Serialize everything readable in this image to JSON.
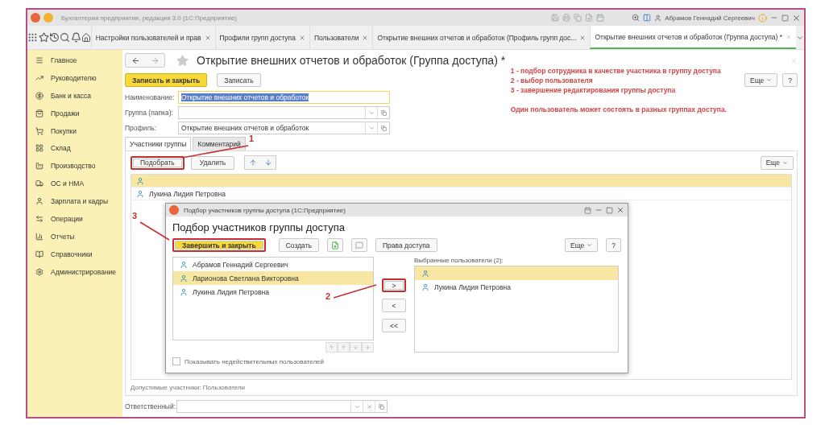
{
  "window": {
    "title": "Бухгалтерия предприятия, редакция 3.0  (1С:Предприятие)",
    "user": "Абрамов Геннадий Сергеевич"
  },
  "tabs": [
    {
      "label": "Настройки пользователей и прав",
      "selected": false
    },
    {
      "label": "Профили групп доступа",
      "selected": false
    },
    {
      "label": "Пользователи",
      "selected": false
    },
    {
      "label": "Открытие внешних отчетов и обработок (Профиль групп дос...",
      "selected": false
    },
    {
      "label": "Открытие внешних отчетов и обработок (Группа доступа) *",
      "selected": true
    }
  ],
  "sidebar": {
    "items": [
      {
        "label": "Главное"
      },
      {
        "label": "Руководителю"
      },
      {
        "label": "Банк и касса"
      },
      {
        "label": "Продажи"
      },
      {
        "label": "Покупки"
      },
      {
        "label": "Склад"
      },
      {
        "label": "Производство"
      },
      {
        "label": "ОС и НМА"
      },
      {
        "label": "Зарплата и кадры"
      },
      {
        "label": "Операции"
      },
      {
        "label": "Отчеты"
      },
      {
        "label": "Справочники"
      },
      {
        "label": "Администрирование"
      }
    ]
  },
  "form": {
    "title": "Открытие внешних отчетов и обработок (Группа доступа) *",
    "buttons": [
      {
        "label": "Записать и закрыть",
        "kind": "primary"
      },
      {
        "label": "Записать",
        "kind": "normal"
      }
    ],
    "more": "Еще",
    "help": "?",
    "fields": [
      {
        "label": "Наименование:",
        "value": "Открытие внешних отчетов и обработок",
        "kind": "text",
        "selected": true
      },
      {
        "label": "Группа (папка):",
        "kind": "select"
      },
      {
        "label": "Профиль:",
        "value": "Открытие внешних отчетов и обработок",
        "kind": "select"
      }
    ],
    "tabs": [
      {
        "label": "Участники группы",
        "selected": true
      },
      {
        "label": "Комментарий",
        "selected": false
      }
    ],
    "toolbar": [
      {
        "label": "Подобрать",
        "highlighted": true
      },
      {
        "label": "Удалить"
      }
    ],
    "table_more": "Еще",
    "rows": [
      {
        "selected": true
      },
      {
        "name": "Лукина Лидия Петровна",
        "selected": false
      }
    ],
    "footer": "Допустимые участники: Пользователи",
    "responsible": {
      "label": "Ответственный:"
    }
  },
  "notes": [
    "1 - подбор сотрудника в качестве участника в группу доступа",
    "2 - выбор пользователя",
    "3 - завершение редактирования группы доступа",
    "Один пользователь может состоять в разных группах доступа."
  ],
  "dialog": {
    "window_title": "Подбор участников группы доступа  (1С:Предприятие)",
    "title": "Подбор участников группы доступа",
    "buttons": [
      {
        "kind": "primary",
        "label": "Завершить и закрыть",
        "highlighted": true
      },
      {
        "kind": "normal",
        "label": "Создать"
      },
      {
        "kind": "add"
      },
      {
        "kind": "comment"
      },
      {
        "kind": "normal",
        "label": "Права доступа"
      }
    ],
    "more": "Еще",
    "help": "?",
    "users": [
      {
        "name": "Абрамов Геннадий Сергеевич",
        "selected": false
      },
      {
        "name": "Ларионова Светлана Викторовна",
        "selected": true
      },
      {
        "name": "Лукина Лидия Петровна",
        "selected": false
      }
    ],
    "move_buttons": [
      {
        "label": ">",
        "highlighted": true
      },
      {
        "label": "<"
      },
      {
        "label": "<<"
      }
    ],
    "chosen_label": "Выбранные пользователи (2):",
    "chosen": [
      {
        "selected": true
      },
      {
        "name": "Лукина Лидия Петровна",
        "selected": false
      }
    ],
    "show_invalid": {
      "label": "Показывать недействительных пользователей",
      "checked": false
    }
  },
  "callouts": [
    {
      "label": "1"
    },
    {
      "label": "2"
    },
    {
      "label": "3"
    }
  ]
}
